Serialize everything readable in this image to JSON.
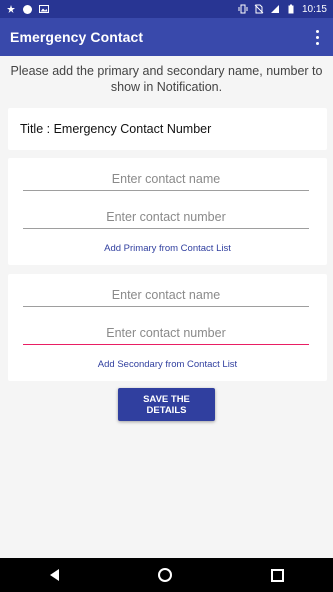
{
  "status": {
    "time": "10:15"
  },
  "appbar": {
    "title": "Emergency Contact"
  },
  "instructions": "Please add the primary and secondary name, number to show in Notification.",
  "title_card": {
    "label": "Title : ",
    "value": "Emergency Contact Number"
  },
  "primary": {
    "name_placeholder": "Enter contact name",
    "number_placeholder": "Enter contact number",
    "link": "Add Primary from Contact List"
  },
  "secondary": {
    "name_placeholder": "Enter contact name",
    "number_placeholder": "Enter contact number",
    "link": "Add Secondary from Contact List"
  },
  "save_button": "SAVE THE DETAILS",
  "colors": {
    "primary_dark": "#283593",
    "primary": "#3949ab",
    "accent": "#e91e63"
  }
}
